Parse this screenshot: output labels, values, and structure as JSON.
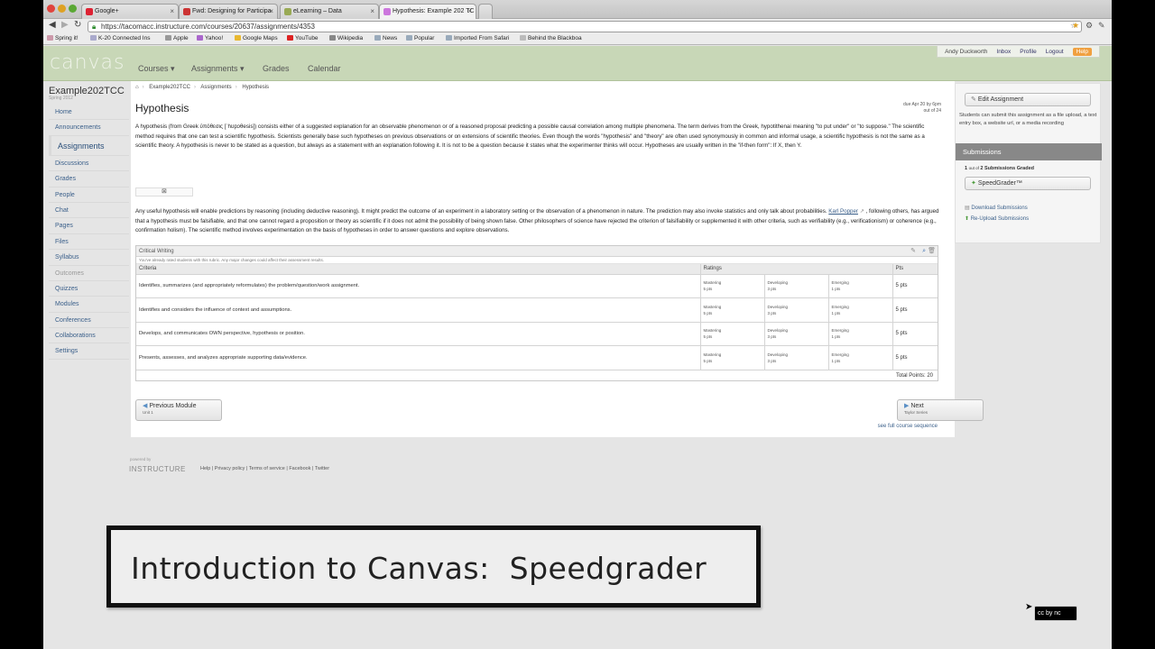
{
  "browser": {
    "tabs": [
      {
        "title": "Google+",
        "color": "#d23"
      },
      {
        "title": "Fwd: Designing for Participa",
        "color": "#c33"
      },
      {
        "title": "eLearning – Data",
        "color": "#9a5"
      },
      {
        "title": "Hypothesis: Example 202 TC",
        "color": "#c7d"
      }
    ],
    "url": "https://tacomacc.instructure.com/courses/20637/assignments/4353",
    "bookmarks": [
      "Spring it!",
      "K-20 Connected Ins",
      "Apple",
      "Yahoo!",
      "Google Maps",
      "YouTube",
      "Wikipedia",
      "News",
      "Popular",
      "Imported From Safari",
      "Behind the Blackboa"
    ]
  },
  "header": {
    "logo": "canvas",
    "nav": [
      "Courses ▾",
      "Assignments ▾",
      "Grades",
      "Calendar"
    ],
    "user": "Andy Duckworth",
    "links": [
      "Inbox",
      "Profile",
      "Logout"
    ],
    "help": "Help"
  },
  "course": {
    "name": "Example202TCC",
    "term": "Spring 2012"
  },
  "leftnav": [
    "Home",
    "Announcements",
    "Assignments",
    "Discussions",
    "Grades",
    "People",
    "Chat",
    "Pages",
    "Files",
    "Syllabus",
    "Outcomes",
    "Quizzes",
    "Modules",
    "Conferences",
    "Collaborations",
    "Settings"
  ],
  "breadcrumb": [
    "Example202TCC",
    "Assignments",
    "Hypothesis"
  ],
  "assignment": {
    "title": "Hypothesis",
    "due": "due Apr 20 by 6pm",
    "points": "out of 24",
    "para1": "A hypothesis (from Greek ὑπόθεσις [ˈhʊpɔθesis]) consists either of a suggested explanation for an observable phenomenon or of a reasoned proposal predicting a possible causal correlation among multiple phenomena. The term derives from the Greek, hypotithenai meaning \"to put under\" or \"to suppose.\" The scientific method requires that one can test a scientific hypothesis. Scientists generally base such hypotheses on previous observations or on extensions of scientific theories. Even though the words \"hypothesis\" and \"theory\" are often used synonymously in common and informal usage, a scientific hypothesis is not the same as a scientific theory. A hypothesis is never to be stated as a question, but always as a statement with an explanation following it. It is not to be a question because it states what the experimenter thinks will occur. Hypotheses are usually written in the \"if-then form\": If X, then Y.",
    "para2_a": "Any useful hypothesis will enable predictions by reasoning (including deductive reasoning). It might predict the outcome of an experiment in a laboratory setting or the observation of a phenomenon in nature. The prediction may also invoke statistics and only talk about probabilities.",
    "para2_link": "Karl Popper",
    "para2_b": ", following others, has argued that a hypothesis must be falsifiable, and that one cannot regard a proposition or theory as scientific if it does not admit the possibility of being shown false. Other philosophers of science have rejected the criterion of falsifiability or supplemented it with other criteria, such as verifiability (e.g., verificationism) or coherence (e.g., confirmation holism). The scientific method involves experimentation on the basis of hypotheses in order to answer questions and explore observations."
  },
  "rubric": {
    "title": "Critical Writing",
    "warning": "You've already rated students with this rubric. Any major changes could affect their assessment results.",
    "headers": [
      "Criteria",
      "Ratings",
      "Pts"
    ],
    "rows": [
      {
        "criterion": "Identifies, summarizes (and appropriately reformulates) the problem/question/work assignment.",
        "ratings": [
          [
            "Mastering",
            "5 pts"
          ],
          [
            "Developing",
            "3 pts"
          ],
          [
            "Emerging",
            "1 pts"
          ]
        ],
        "pts": "5 pts"
      },
      {
        "criterion": "Identifies and considers the influence of context and assumptions.",
        "ratings": [
          [
            "Mastering",
            "5 pts"
          ],
          [
            "Developing",
            "3 pts"
          ],
          [
            "Emerging",
            "1 pts"
          ]
        ],
        "pts": "5 pts"
      },
      {
        "criterion": "Develops, and communicates OWN perspective, hypothesis or position.",
        "ratings": [
          [
            "Mastering",
            "5 pts"
          ],
          [
            "Developing",
            "3 pts"
          ],
          [
            "Emerging",
            "1 pts"
          ]
        ],
        "pts": "5 pts"
      },
      {
        "criterion": "Presents, assesses, and analyzes appropriate supporting data/evidence.",
        "ratings": [
          [
            "Mastering",
            "5 pts"
          ],
          [
            "Developing",
            "3 pts"
          ],
          [
            "Emerging",
            "1 pts"
          ]
        ],
        "pts": "5 pts"
      }
    ],
    "total": "Total Points: 20"
  },
  "modules": {
    "prev_label": "Previous Module",
    "prev_sub": "Unit 1",
    "next_label": "Next",
    "next_sub": "Taylor Series",
    "sequence": "see full course sequence"
  },
  "sidebar": {
    "edit_button": "Edit Assignment",
    "description": "Students can submit this assignment as a file upload, a text entry box, a website url, or a media recording",
    "submissions_title": "Submissions",
    "graded_count": "1",
    "graded_mid": "out of",
    "graded_total": "2 Submissions Graded",
    "speedgrader": "SpeedGrader™",
    "download": "Download Submissions",
    "reupload": "Re-Upload Submissions"
  },
  "footer": {
    "powered": "powered by",
    "logo": "INSTRUCTURE",
    "links": "Help | Privacy policy | Terms of service | Facebook | Twitter"
  },
  "caption": "Introduction to Canvas:  Speedgrader",
  "license": "cc by nc"
}
